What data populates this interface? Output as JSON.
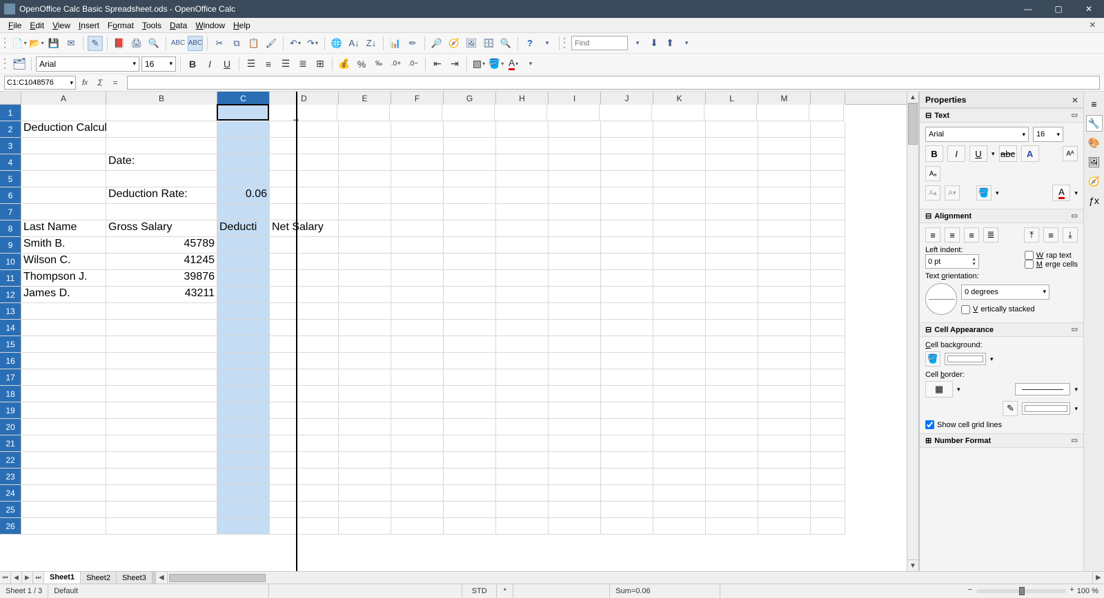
{
  "title": "OpenOffice Calc Basic Spreadsheet.ods - OpenOffice Calc",
  "menu": [
    "File",
    "Edit",
    "View",
    "Insert",
    "Format",
    "Tools",
    "Data",
    "Window",
    "Help"
  ],
  "find": {
    "placeholder": "Find"
  },
  "font": {
    "name": "Arial",
    "size": "16"
  },
  "namebox": "C1:C1048576",
  "formula": "",
  "columns": [
    "A",
    "B",
    "C",
    "D",
    "E",
    "F",
    "G",
    "H",
    "I",
    "J",
    "K",
    "L",
    "M"
  ],
  "data": {
    "A2": "Deduction Calculations for Employees",
    "B4": "Date:",
    "B6": "Deduction Rate:",
    "C6": "0.06",
    "A8": "Last Name",
    "B8": "Gross Salary",
    "C8": "Deduction",
    "D8": "Net Salary",
    "A9": "Smith B.",
    "B9": "45789",
    "A10": "Wilson C.",
    "B10": "41245",
    "A11": "Thompson J.",
    "B11": "39876",
    "A12": "James D.",
    "B12": "43211"
  },
  "sheets": [
    "Sheet1",
    "Sheet2",
    "Sheet3"
  ],
  "status": {
    "sheet": "Sheet 1 / 3",
    "style": "Default",
    "mode": "STD",
    "extra": "*",
    "sum": "Sum=0.06",
    "zoom": "100 %"
  },
  "sidebar": {
    "title": "Properties",
    "text_section": "Text",
    "alignment_section": "Alignment",
    "cell_section": "Cell Appearance",
    "number_section": "Number Format",
    "left_indent_label": "Left indent:",
    "left_indent_val": "0 pt",
    "wrap": "Wrap text",
    "merge": "Merge cells",
    "orient_label": "Text orientation:",
    "orient_val": "0 degrees",
    "vstack": "Vertically stacked",
    "cellbg": "Cell background:",
    "cellborder": "Cell border:",
    "gridlines": "Show cell grid lines"
  }
}
